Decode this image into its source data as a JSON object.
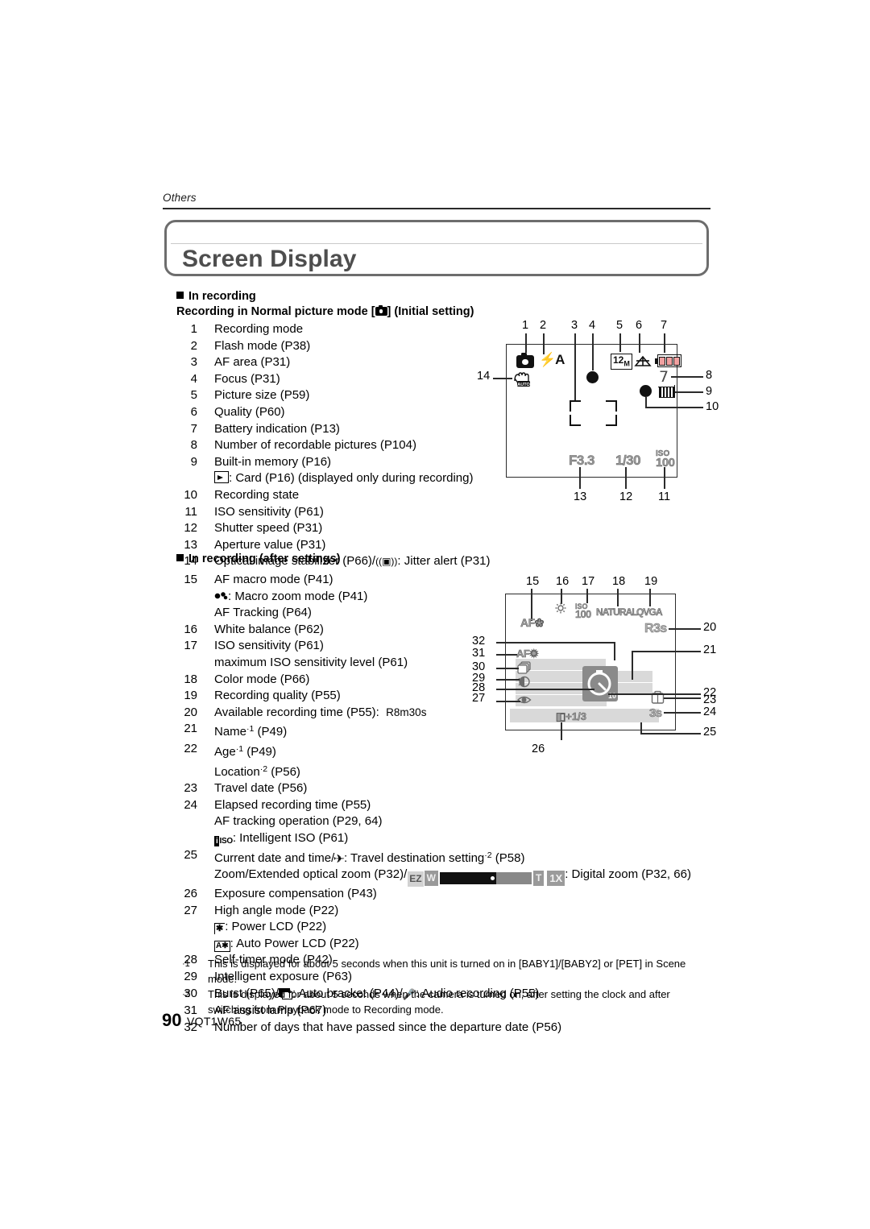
{
  "header": {
    "running_head": "Others",
    "title": "Screen Display"
  },
  "section1": {
    "heading": "In recording",
    "subheading_pre": "Recording in Normal picture mode [",
    "subheading_post": "] (Initial setting)",
    "items": [
      {
        "num": "1",
        "text": "Recording mode"
      },
      {
        "num": "2",
        "text": "Flash mode (P38)"
      },
      {
        "num": "3",
        "text": "AF area (P31)"
      },
      {
        "num": "4",
        "text": "Focus (P31)"
      },
      {
        "num": "5",
        "text": "Picture size (P59)"
      },
      {
        "num": "6",
        "text": "Quality (P60)"
      },
      {
        "num": "7",
        "text": "Battery indication (P13)"
      },
      {
        "num": "8",
        "text": "Number of recordable pictures (P104)"
      },
      {
        "num": "9",
        "text": "Built-in memory (P16)"
      },
      {
        "num": "",
        "text": ": Card (P16) (displayed only during recording)",
        "icon": "card-arrow-icon"
      },
      {
        "num": "10",
        "text": "Recording state"
      },
      {
        "num": "11",
        "text": "ISO sensitivity (P61)"
      },
      {
        "num": "12",
        "text": "Shutter speed (P31)"
      },
      {
        "num": "13",
        "text": "Aperture value (P31)"
      },
      {
        "num": "14",
        "text": "Optical image stabilizer (P66)/",
        "text2": ": Jitter alert (P31)",
        "icon": "jitter-alert-icon"
      }
    ]
  },
  "section2": {
    "heading": "In recording (after settings)",
    "items": [
      {
        "num": "15",
        "text": "AF macro mode (P41)"
      },
      {
        "num": "",
        "text": ": Macro zoom mode (P41)",
        "icon": "macro-zoom-icon"
      },
      {
        "num": "",
        "text": "AF Tracking (P64)"
      },
      {
        "num": "16",
        "text": "White balance (P62)"
      },
      {
        "num": "17",
        "text": "ISO sensitivity (P61)"
      },
      {
        "num": "",
        "text": "maximum ISO sensitivity level (P61)"
      },
      {
        "num": "18",
        "text": "Color mode (P66)"
      },
      {
        "num": "19",
        "text": "Recording quality (P55)"
      },
      {
        "num": "20",
        "text": "Available recording time (P55):",
        "value": "R8m30s"
      },
      {
        "num": "21",
        "text": "Name",
        "sup": "·1",
        "text2": " (P49)"
      },
      {
        "num": "22",
        "text": "Age",
        "sup": "·1",
        "text2": " (P49)"
      },
      {
        "num": "",
        "text": "Location",
        "sup": "·2",
        "text2": " (P56)"
      },
      {
        "num": "23",
        "text": "Travel date (P56)"
      },
      {
        "num": "24",
        "text": "Elapsed recording time (P55)"
      },
      {
        "num": "",
        "text": "AF tracking operation (P29, 64)"
      },
      {
        "num": "",
        "text": ": Intelligent ISO (P61)",
        "icon": "intelligent-iso-icon"
      },
      {
        "num": "25",
        "text": "Current date and time/",
        "text2": ": Travel destination setting",
        "sup": "·2",
        "text3": " (P58)",
        "icon": "travel-plane-icon"
      },
      {
        "num": "",
        "text": "Zoom/Extended optical zoom (P32)/",
        "text2": ": Digital zoom (P32, 66)",
        "icon": "zoom-bar-icon"
      },
      {
        "num": "26",
        "text": "Exposure compensation (P43)"
      },
      {
        "num": "27",
        "text": "High angle mode (P22)"
      },
      {
        "num": "",
        "text": ": Power LCD (P22)",
        "icon": "power-lcd-icon"
      },
      {
        "num": "",
        "text": ": Auto Power LCD (P22)",
        "icon": "auto-power-lcd-icon"
      },
      {
        "num": "28",
        "text": "Self-timer mode (P42)"
      },
      {
        "num": "29",
        "text": "Intelligent exposure (P63)"
      },
      {
        "num": "30",
        "text": "Burst (P65)/",
        "text2": ": Auto bracket (P44)/",
        "text3": ": Audio recording (P55)",
        "icon": "auto-bracket-icon",
        "icon2": "microphone-icon"
      },
      {
        "num": "31",
        "text": "AF assist lamp (P67)"
      },
      {
        "num": "32",
        "text": "Number of days that have passed since the departure date (P56)"
      }
    ]
  },
  "footnotes": [
    {
      "mark": "·1",
      "text": "This is displayed for about 5 seconds when this unit is turned on in [BABY1]/[BABY2] or [PET] in Scene mode."
    },
    {
      "mark": "·2",
      "text": "This is displayed for about 5 seconds when the camera is turned on, after setting the clock and after switching from Playback mode to Recording mode."
    }
  ],
  "footer": {
    "page_number": "90",
    "doc_id": "VQT1W65"
  },
  "diagram1": {
    "name": "normal-picture-mode-screen",
    "callouts": [
      "1",
      "2",
      "3",
      "4",
      "5",
      "6",
      "7",
      "8",
      "9",
      "10",
      "11",
      "12",
      "13",
      "14"
    ],
    "icons": {
      "recording_mode": "camera-icon",
      "flash_mode": "⚡A",
      "picture_size": "12M",
      "quality": "quality-icon",
      "battery": "battery-icon",
      "recordable_pictures": "7",
      "memory": "built-in-memory-icon",
      "recording_state": "red-dot-icon",
      "ois": "optical-image-stabilizer-auto-icon"
    },
    "values": {
      "aperture": "F3.3",
      "shutter": "1/30",
      "iso_label": "ISO",
      "iso_value": "100"
    }
  },
  "diagram2": {
    "name": "after-settings-screen",
    "callouts": [
      "15",
      "16",
      "17",
      "18",
      "19",
      "20",
      "21",
      "22",
      "23",
      "24",
      "25",
      "26",
      "27",
      "28",
      "29",
      "30",
      "31",
      "32"
    ],
    "icons": {
      "af_macro": "AF❀",
      "white_balance": "sun-icon",
      "iso_label": "ISO",
      "iso_value": "100",
      "color_mode": "NATURAL",
      "recording_quality": "QVGA",
      "available_time": "R3s",
      "af_assist_lamp": "AF✹",
      "burst": "burst-icon",
      "intelligent_exposure": "i-exposure-icon",
      "high_angle": "high-angle-icon",
      "self_timer": "self-timer-icon",
      "self_timer_count": "10",
      "travel_date": "travel-date-icon",
      "elapsed_time": "3s",
      "exposure_comp": "◧+1/3"
    }
  }
}
